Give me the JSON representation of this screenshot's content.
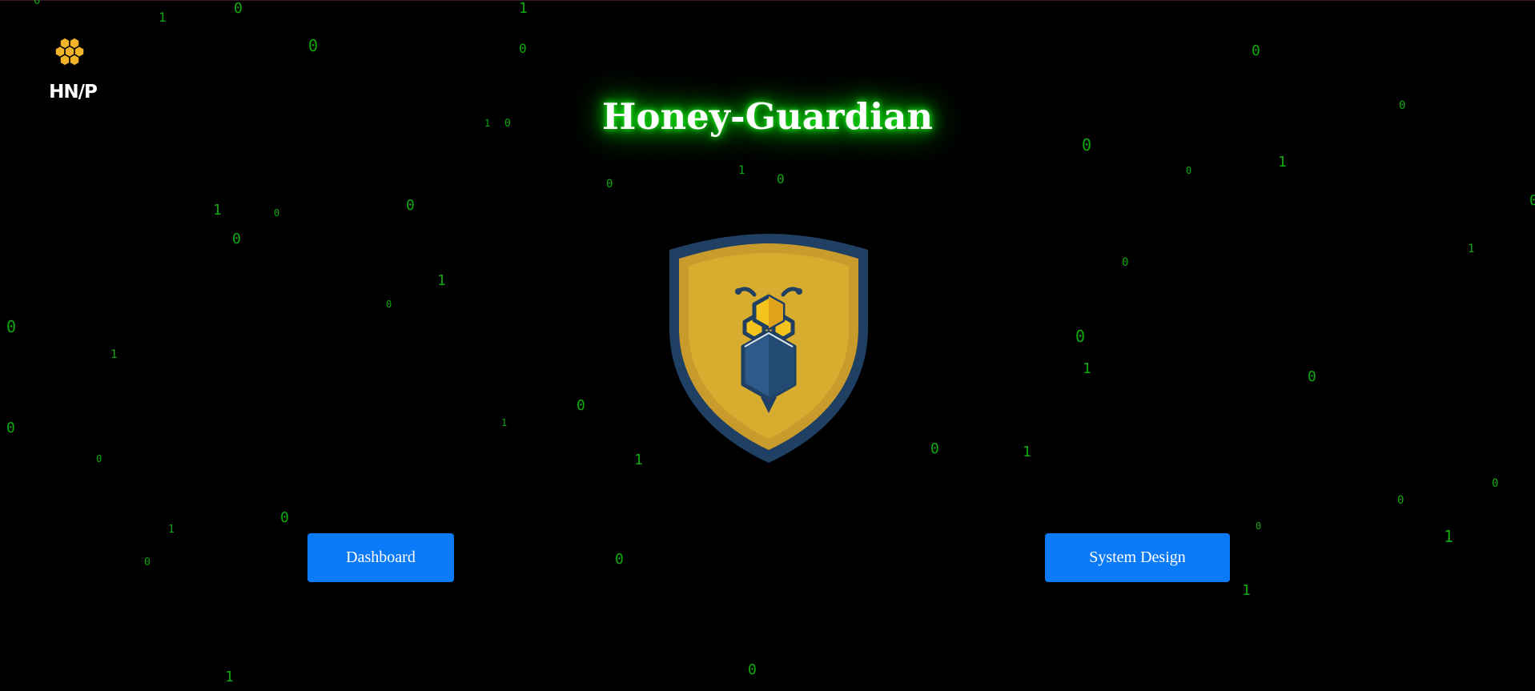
{
  "app": {
    "logo_text": "HN/P",
    "title": "Honey-Guardian"
  },
  "colors": {
    "background": "#000000",
    "matrix_green": "#0fa80f",
    "title_glow": "#00e000",
    "button_blue": "#0a7af8",
    "honey_yellow": "#f0b429",
    "shield_navy": "#1f3f63"
  },
  "icons": {
    "logo": "honeycomb-logo-icon",
    "emblem": "bee-shield-icon"
  },
  "buttons": {
    "dashboard": "Dashboard",
    "system_design": "System Design"
  },
  "matrix_digits": [
    "0",
    "1",
    "0",
    "0",
    "1",
    "0",
    "1",
    "0",
    "1",
    "0",
    "0",
    "0",
    "0",
    "1",
    "0",
    "0",
    "1",
    "0",
    "0",
    "0",
    "1",
    "0",
    "0",
    "1",
    "0",
    "0",
    "0",
    "1",
    "0",
    "0",
    "1",
    "0",
    "0",
    "1",
    "1",
    "0",
    "1",
    "0",
    "0",
    "0",
    "1",
    "1",
    "0",
    "0",
    "0",
    "1",
    "1",
    "0",
    "0",
    "1",
    "0",
    "1",
    "0",
    "1"
  ]
}
